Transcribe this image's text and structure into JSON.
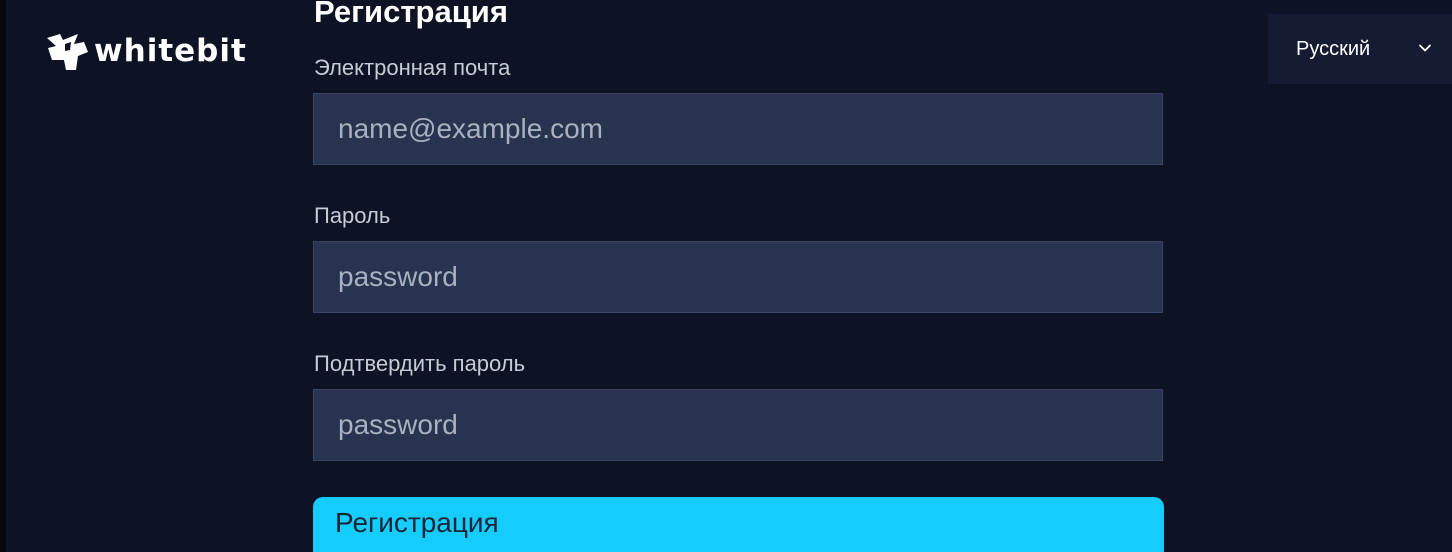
{
  "brand": {
    "name": "whitebit",
    "logo_icon": "whitebit-bull-logo-icon"
  },
  "language": {
    "selected": "Русский",
    "chevron_icon": "chevron-down-icon"
  },
  "form": {
    "title": "Регистрация",
    "email": {
      "label": "Электронная почта",
      "value": "",
      "placeholder": "name@example.com"
    },
    "password": {
      "label": "Пароль",
      "value": "",
      "placeholder": "password"
    },
    "confirm_password": {
      "label": "Подтвердить пароль",
      "value": "",
      "placeholder": "password"
    },
    "submit_label": "Регистрация"
  },
  "colors": {
    "background": "#0d1324",
    "input_background": "#283350",
    "accent": "#14cdfc",
    "language_background": "#141b33"
  }
}
